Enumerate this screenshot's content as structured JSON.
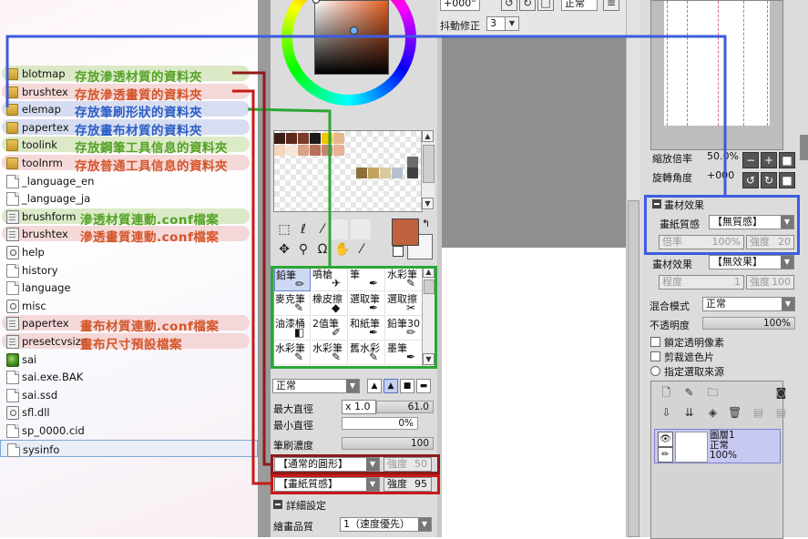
{
  "files": [
    {
      "name": "blotmap",
      "type": "folder",
      "note": "存放滲透材質的資料夾",
      "hl": "g"
    },
    {
      "name": "brushtex",
      "type": "folder",
      "note": "存放滲透畫質的資料夾",
      "hl": "r"
    },
    {
      "name": "elemap",
      "type": "folder",
      "note": "存放筆刷形狀的資料夾",
      "hl": "b"
    },
    {
      "name": "papertex",
      "type": "folder",
      "note": "存放畫布材質的資料夾",
      "hl": "b"
    },
    {
      "name": "toolink",
      "type": "folder",
      "note": "存放鋼筆工具信息的資料夾",
      "hl": "g"
    },
    {
      "name": "toolnrm",
      "type": "folder",
      "note": "存放普通工具信息的資料夾",
      "hl": "r"
    },
    {
      "name": "_language_en",
      "type": "file",
      "note": "",
      "hl": ""
    },
    {
      "name": "_language_ja",
      "type": "file",
      "note": "",
      "hl": ""
    },
    {
      "name": "brushform",
      "type": "conf",
      "note": "滲透材質連動.conf檔案",
      "hl": "g"
    },
    {
      "name": "brushtex",
      "type": "conf",
      "note": "滲透畫質連動.conf檔案",
      "hl": "r"
    },
    {
      "name": "help",
      "type": "gear",
      "note": "",
      "hl": ""
    },
    {
      "name": "history",
      "type": "file",
      "note": "",
      "hl": ""
    },
    {
      "name": "language",
      "type": "file",
      "note": "",
      "hl": ""
    },
    {
      "name": "misc",
      "type": "gear",
      "note": "",
      "hl": ""
    },
    {
      "name": "papertex",
      "type": "conf",
      "note": "畫布材質連動.conf檔案",
      "hl": "r"
    },
    {
      "name": "presetcvsize",
      "type": "conf",
      "note": "畫布尺寸預設檔案",
      "hl": "r"
    },
    {
      "name": "sai",
      "type": "app",
      "note": "",
      "hl": ""
    },
    {
      "name": "sai.exe.BAK",
      "type": "file",
      "note": "",
      "hl": ""
    },
    {
      "name": "sai.ssd",
      "type": "file",
      "note": "",
      "hl": ""
    },
    {
      "name": "sfl.dll",
      "type": "gear",
      "note": "",
      "hl": ""
    },
    {
      "name": "sp_0000.cid",
      "type": "file",
      "note": "",
      "hl": ""
    },
    {
      "name": "sysinfo",
      "type": "file",
      "note": "",
      "hl": ""
    }
  ],
  "toolbar": {
    "angle_value": "+000°",
    "mode_value": "正常",
    "stabilizer_label": "抖動修正",
    "stabilizer_value": "3"
  },
  "swatches": [
    "#3a1d14",
    "#5b2a1e",
    "#7a3b27",
    "#1b1b1b",
    "#f0c800",
    "#e6b88e",
    "#f2d5bb",
    "#f5e7d8",
    "#d8a188",
    "#b76f57",
    "#c3876c",
    "#e9b196",
    "#8d6f3a",
    "#c2a45f",
    "#dcc9a4",
    "#b7c0ce",
    "#6b6b6b",
    "#404040"
  ],
  "tools": {
    "brushes": [
      "鉛筆",
      "噴槍",
      "筆",
      "水彩筆",
      "麥克筆",
      "橡皮擦",
      "選取筆",
      "選取擦",
      "油漆桶",
      "2值筆",
      "和紙筆",
      "鉛筆30",
      "水彩筆",
      "水彩筆",
      "舊水彩",
      "墨筆"
    ],
    "blend_mode": "正常",
    "max_size_label": "最大直徑",
    "max_size_mult": "x 1.0",
    "max_size_value": "61.0",
    "min_size_label": "最小直徑",
    "min_size_value": "0%",
    "density_label": "筆刷濃度",
    "density_value": "100",
    "shape_value": "【通常的圓形】",
    "shape_strength_label": "強度",
    "shape_strength_value": "50",
    "texture_value": "【畫紙質感】",
    "texture_strength_label": "強度",
    "texture_strength_value": "95",
    "detail_label": "詳細設定",
    "quality_label": "繪畫品質",
    "quality_value": "1（速度優先）"
  },
  "right": {
    "zoom_label": "縮放倍率",
    "zoom_value": "50.0%",
    "rotate_label": "旋轉角度",
    "rotate_value": "+000",
    "paper_effect_header": "畫材效果",
    "paper_texture_label": "畫紙質感",
    "paper_texture_value": "【無質感】",
    "ratio_label": "倍率",
    "ratio_value": "100%",
    "strength_label": "強度",
    "strength_value": "20",
    "brush_effect_label": "畫材效果",
    "brush_effect_value": "【無效果】",
    "degree_label": "程度",
    "degree_value": "1",
    "degree_strength_label": "強度",
    "degree_strength_value": "100",
    "blend_label": "混合模式",
    "blend_value": "正常",
    "opacity_label": "不透明度",
    "opacity_value": "100%",
    "opt_lock_alpha": "鎖定透明像素",
    "opt_clipping": "剪裁遮色片",
    "opt_sample_source": "指定選取來源",
    "layer_name": "圖層1",
    "layer_mode": "正常",
    "layer_opacity": "100%"
  }
}
